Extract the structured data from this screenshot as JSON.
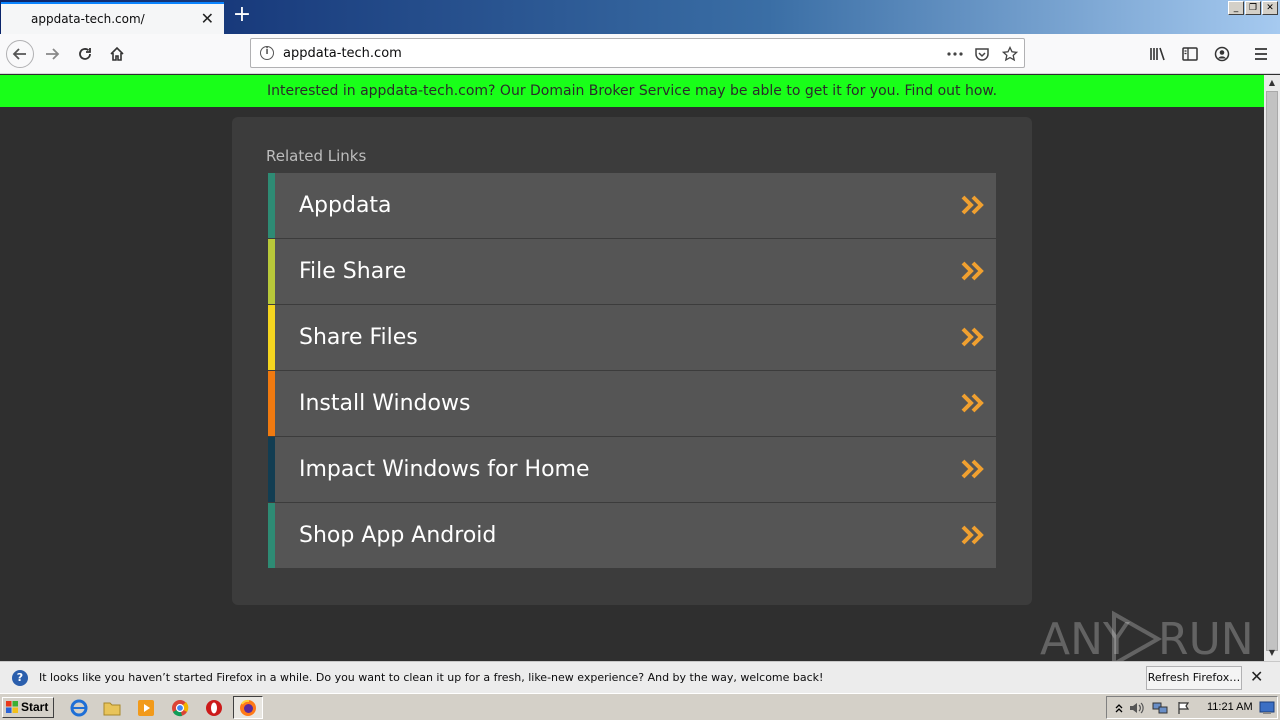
{
  "browser": {
    "tab_title": "appdata-tech.com/",
    "url": "appdata-tech.com"
  },
  "banner": {
    "text": "Interested in appdata-tech.com? Our Domain Broker Service may be able to get it for you. Find out how."
  },
  "content": {
    "section_title": "Related Links",
    "links": [
      {
        "label": "Appdata",
        "accent": "#2e8b74"
      },
      {
        "label": "File Share",
        "accent": "#b8c83a"
      },
      {
        "label": "Share Files",
        "accent": "#f5d51f"
      },
      {
        "label": "Install Windows",
        "accent": "#f07a10"
      },
      {
        "label": "Impact Windows for Home",
        "accent": "#123d52"
      },
      {
        "label": "Shop App Android",
        "accent": "#2e8b74"
      }
    ],
    "arrow_color": "#f0a030"
  },
  "watermark": {
    "text_left": "ANY",
    "text_right": "RUN"
  },
  "notification": {
    "text": "It looks like you haven’t started Firefox in a while. Do you want to clean it up for a fresh, like-new experience? And by the way, welcome back!",
    "button_label": "Refresh Firefox…"
  },
  "taskbar": {
    "start_label": "Start",
    "clock": "11:21 AM"
  }
}
